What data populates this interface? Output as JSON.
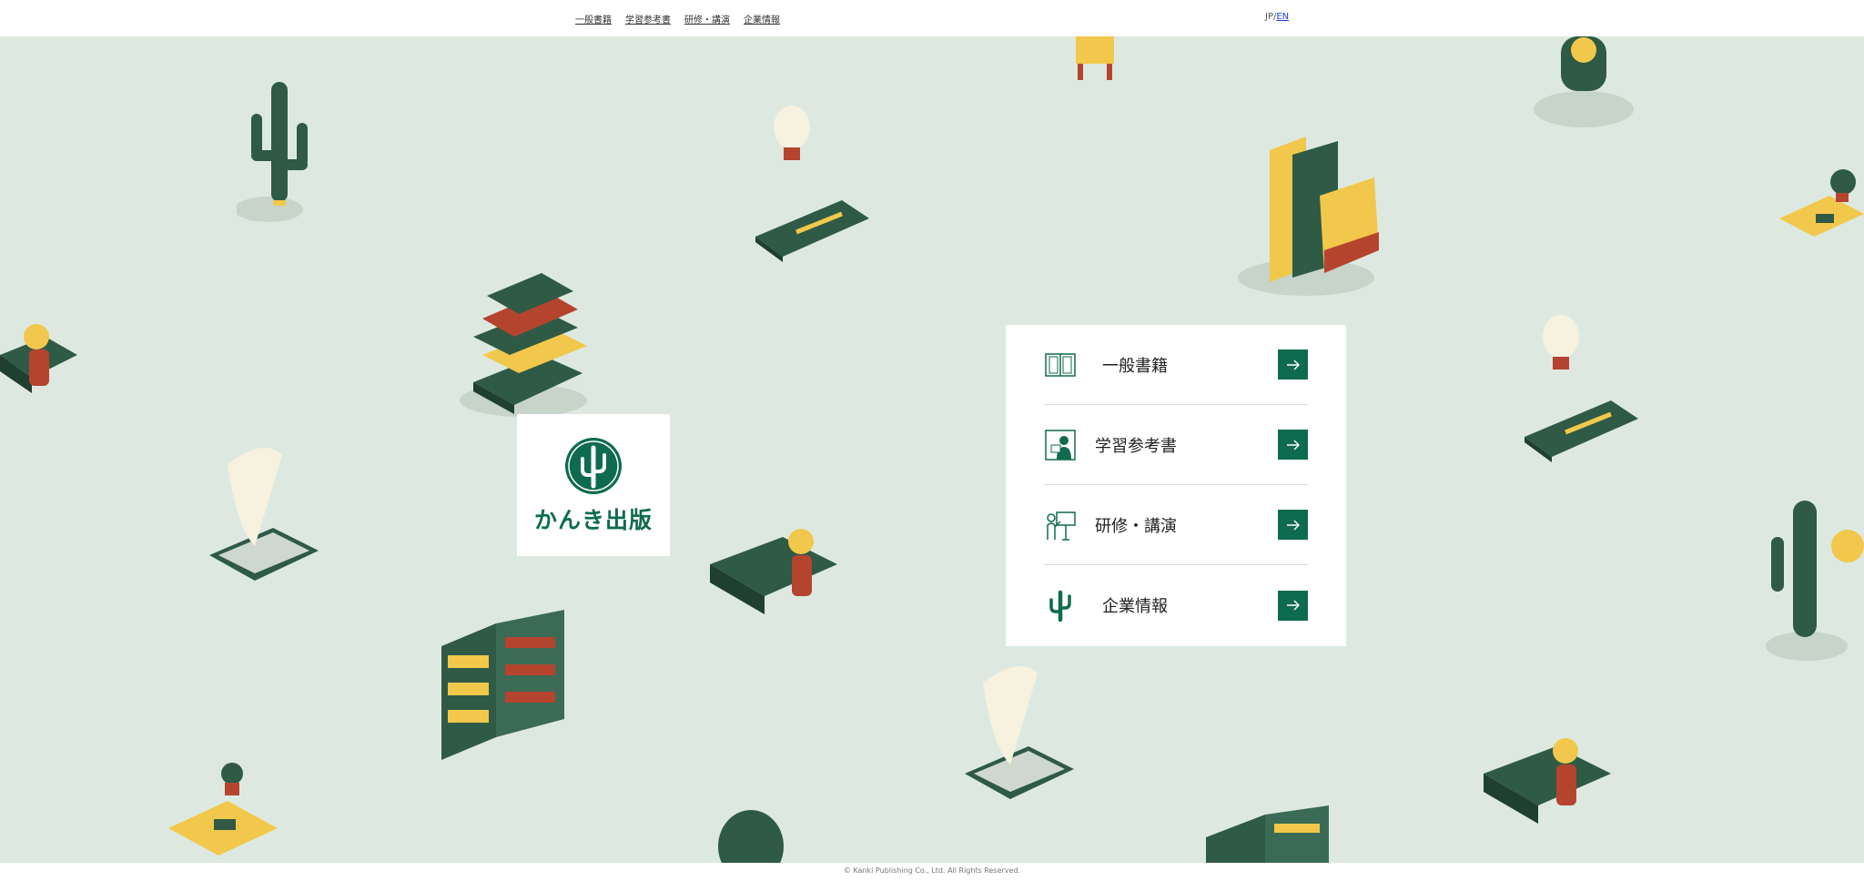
{
  "header": {
    "nav": [
      {
        "label": "一般書籍"
      },
      {
        "label": "学習参考書"
      },
      {
        "label": "研修・講演"
      },
      {
        "label": "企業情報"
      }
    ],
    "lang": {
      "jp": "JP",
      "separator": "/",
      "en": "EN"
    }
  },
  "brand": {
    "name": "かんき出版",
    "color": "#0f6b4f"
  },
  "menu": {
    "items": [
      {
        "label": "一般書籍",
        "icon": "open-book-icon"
      },
      {
        "label": "学習参考書",
        "icon": "student-reading-icon"
      },
      {
        "label": "研修・講演",
        "icon": "lecture-presenter-icon"
      },
      {
        "label": "企業情報",
        "icon": "cactus-icon"
      }
    ]
  },
  "colors": {
    "background": "#dde9e0",
    "accent": "#0f6b4f",
    "yellow": "#f1c84b",
    "red": "#b5442f"
  },
  "footer": {
    "copyright": "© Kanki Publishing Co., Ltd. All Rights Reserved."
  }
}
